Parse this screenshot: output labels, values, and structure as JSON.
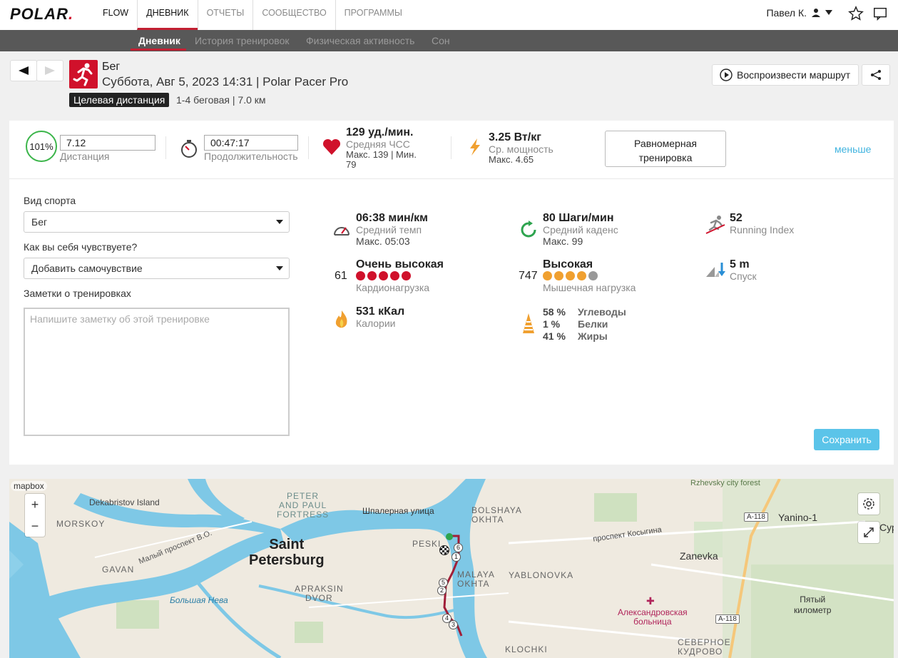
{
  "topbar": {
    "logo": "POLAR",
    "nav": [
      "FLOW",
      "ДНЕВНИК",
      "ОТЧЕТЫ",
      "СООБЩЕСТВО",
      "ПРОГРАММЫ"
    ],
    "user_name": "Павел К."
  },
  "subnav": [
    "Дневник",
    "История тренировок",
    "Физическая активность",
    "Сон"
  ],
  "header": {
    "sport": "Бег",
    "date_line": "Суббота, Авг 5, 2023 14:31 | Polar Pacer Pro",
    "target_tag": "Целевая дистанция",
    "target_desc": "1-4 беговая  | 7.0 км",
    "replay_label": "Воспроизвести маршрут"
  },
  "summary": {
    "percent": "101%",
    "distance_value": "7.12",
    "distance_label": "Дистанция",
    "duration_value": "00:47:17",
    "duration_label": "Продолжительность",
    "hr_value": "129 уд./мин.",
    "hr_label": "Средняя ЧСС",
    "hr_minmax": "Макс. 139  |  Мин.",
    "hr_min_wrap": "79",
    "power_value": "3.25 Вт/кг",
    "power_label": "Ср. мощность",
    "power_max": "Макс. 4.65",
    "evenness_line1": "Равномерная",
    "evenness_line2": "тренировка",
    "less_label": "меньше"
  },
  "form": {
    "sport_label": "Вид спорта",
    "sport_value": "Бег",
    "feel_label": "Как вы себя чувствуете?",
    "feel_value": "Добавить самочувствие",
    "notes_label": "Заметки о тренировках",
    "notes_placeholder": "Напишите заметку об этой тренировке",
    "save_label": "Сохранить"
  },
  "stats": {
    "pace_value": "06:38 мин/км",
    "pace_label": "Средний темп",
    "pace_max": "Макс. 05:03",
    "cadence_value": "80 Шаги/мин",
    "cadence_label": "Средний каденс",
    "cadence_max": "Макс. 99",
    "running_index_value": "52",
    "running_index_label": "Running Index",
    "cardio_number": "61",
    "cardio_value": "Очень высокая",
    "cardio_label": "Кардионагрузка",
    "cardio_dots": 5,
    "muscle_number": "747",
    "muscle_value": "Высокая",
    "muscle_label": "Мышечная нагрузка",
    "muscle_dots": 4,
    "descent_value": "5 m",
    "descent_label": "Спуск",
    "calories_value": "531 кКал",
    "calories_label": "Калории",
    "carbs_pct": "58 %",
    "carbs_label": "Углеводы",
    "protein_pct": "1 %",
    "protein_label": "Белки",
    "fat_pct": "41 %",
    "fat_label": "Жиры"
  },
  "map": {
    "attribution": "mapbox",
    "labels": {
      "dekabristov": "Dekabristov Island",
      "morskoy": "MORSKOY",
      "gavan": "GAVAN",
      "malyy": "Малый проспект В.О.",
      "bolshaya_neva": "Большая Нева",
      "peter_paul": "PETER\nAND PAUL\nFORTRESS",
      "shpalernaya": "Шпалерная улица",
      "city": "Saint\nPetersburg",
      "apraksin": "APRAKSIN\nDVOR",
      "peski": "PESKI",
      "bolshaya_okhta": "BOLSHAYA\nOKHTA",
      "malaya_okhta": "MALAYA\nOKHTA",
      "yablonovka": "YABLONOVKA",
      "kosygina": "проспект Косыгина",
      "zanevka": "Zanevka",
      "yanino": "Yanino-1",
      "sur": "Сур",
      "road_a118_1": "A-118",
      "road_a118_2": "A-118",
      "hospital": "Александровская\nбольница",
      "pyatyy": "Пятый\nкилометр",
      "klochki": "KLOCHKI",
      "kudrovo": "СЕВЕРНОЕ\nКУДРОВО",
      "forest": "Rzhevsky city forest"
    },
    "route_markers": [
      "6",
      "1",
      "5",
      "2",
      "4",
      "3"
    ],
    "icons": {
      "zoom_in": "+",
      "zoom_out": "−"
    }
  },
  "colors": {
    "accent": "#c21f32",
    "brand_red": "#d0112b",
    "save_blue": "#5bc4e9",
    "cardio_dot": "#d0112b",
    "muscle_dot": "#f0a030",
    "muscle_dot_empty": "#999999",
    "ring_green": "#3bb54a"
  }
}
